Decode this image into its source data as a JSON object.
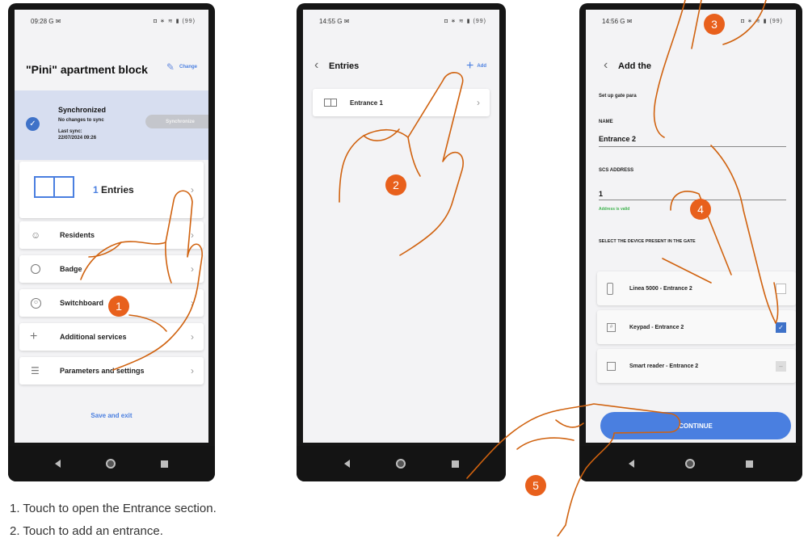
{
  "phone1": {
    "status_time": "09:28",
    "status_left_icons": "G ✉",
    "status_right_icons": "◘ ∗ ≋ ▮ (99)",
    "title": "\"Pini\" apartment block",
    "change_label": "Change",
    "sync": {
      "title": "Synchronized",
      "subtitle": "No changes to sync",
      "last_sync_label": "Last sync:",
      "last_sync_value": "22/07/2024 09:26",
      "button_label": "Synchronize"
    },
    "entries_count": "1",
    "entries_label": "Entries",
    "menu": [
      {
        "label": "Residents",
        "icon": "person-icon"
      },
      {
        "label": "Badge",
        "icon": "badge-icon"
      },
      {
        "label": "Switchboard",
        "icon": "switchboard-icon"
      },
      {
        "label": "Additional services",
        "icon": "plus-icon"
      },
      {
        "label": "Parameters and settings",
        "icon": "sliders-icon"
      }
    ],
    "save_exit": "Save and exit"
  },
  "phone2": {
    "status_time": "14:55",
    "status_left_icons": "G ✉",
    "status_right_icons": "◘ ∗ ≋ ▮ (99)",
    "title": "Entries",
    "add_label": "Add",
    "entry_label": "Entrance 1"
  },
  "phone3": {
    "status_time": "14:56",
    "status_left_icons": "G ✉",
    "status_right_icons": "◘ ∗ ≋ ▮ (99)",
    "title": "Add the",
    "subtitle": "Set up gate para",
    "name_label": "NAME",
    "name_value": "Entrance 2",
    "scs_label": "SCS ADDRESS",
    "scs_value": "1",
    "address_valid": "Address is valid",
    "select_label": "SELECT THE DEVICE PRESENT IN THE GATE",
    "devices": [
      {
        "label": "Linea 5000 - Entrance 2",
        "checked": false
      },
      {
        "label": "Keypad - Entrance 2",
        "checked": true
      },
      {
        "label": "Smart reader - Entrance 2",
        "checked": false
      }
    ],
    "continue_label": "CONTINUE"
  },
  "badges": [
    "1",
    "2",
    "3",
    "4",
    "5"
  ],
  "captions": [
    "1.   Touch to open the Entrance section.",
    "2.   Touch to add an entrance."
  ],
  "colors": {
    "accent_orange": "#e8601c",
    "sync_panel": "#d7def0",
    "primary_blue": "#4a7fe0",
    "check_blue": "#3f72c8",
    "valid_green": "#3fb34f"
  }
}
